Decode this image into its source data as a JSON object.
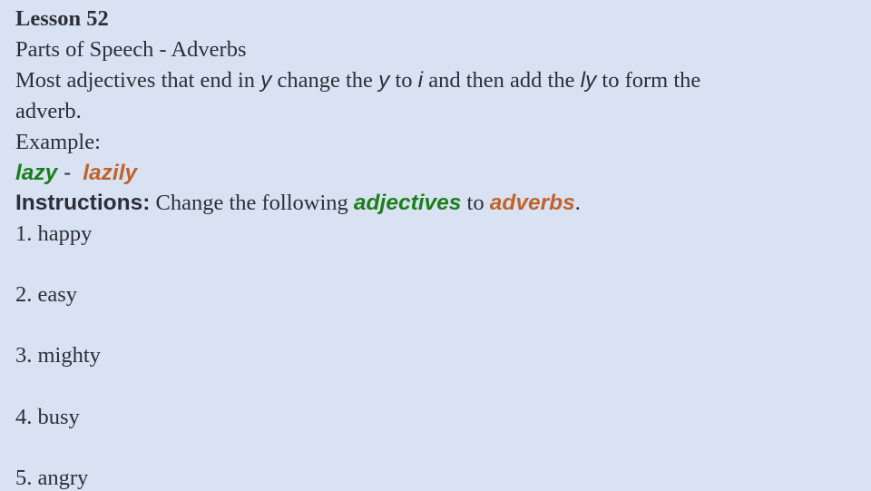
{
  "lesson_title": "Lesson 52",
  "subtitle": "Parts of Speech - Adverbs",
  "rule": {
    "part1": "Most adjectives that end in ",
    "y1": "y",
    "part2": " change the ",
    "y2": "y",
    "part3": " to ",
    "i": "i",
    "part4": " and then add the ",
    "ly": "ly",
    "part5": " to form the",
    "line2": "adverb."
  },
  "example_label": "Example:",
  "example": {
    "adjective": "lazy",
    "separator": " - ",
    "adverb": "lazily"
  },
  "instructions": {
    "label": "Instructions:",
    "text1": " Change the following ",
    "adjectives": "adjectives",
    "text2": " to ",
    "adverbs": "adverbs",
    "text3": "."
  },
  "items": [
    "1. happy",
    "2. easy",
    "3. mighty",
    "4. busy",
    "5. angry"
  ],
  "colors": {
    "background": "#d9e2f3",
    "text": "#2b2f38",
    "adjective": "#1a7f1a",
    "adverb": "#c0632b"
  }
}
